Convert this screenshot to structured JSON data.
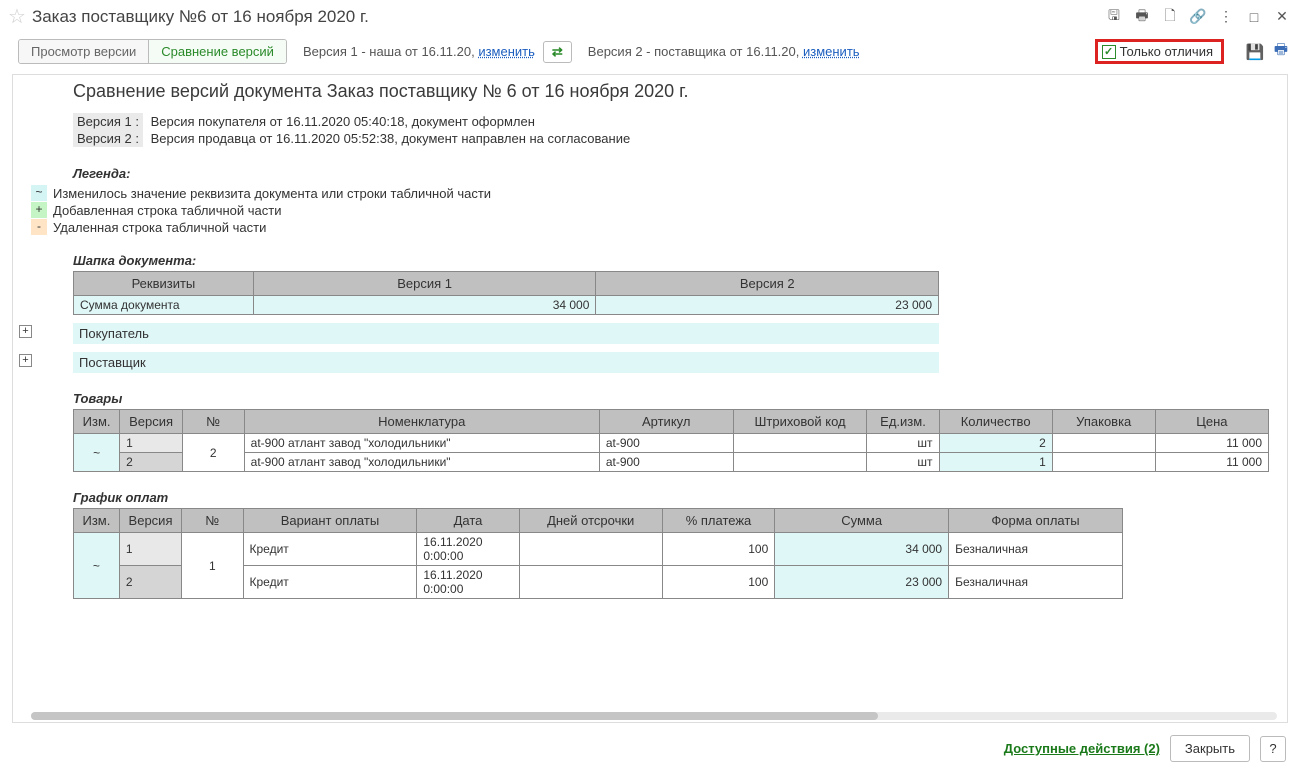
{
  "window": {
    "title": "Заказ поставщику №6 от 16 ноября 2020 г."
  },
  "toolbar": {
    "view_version": "Просмотр версии",
    "compare_versions": "Сравнение версий",
    "version1_text": "Версия 1 - наша от 16.11.20, ",
    "version2_text": "Версия 2 - поставщика от 16.11.20, ",
    "change_link": "изменить",
    "swap_glyph": "⇄",
    "diff_only": "Только отличия"
  },
  "doc": {
    "compare_title": "Сравнение версий документа Заказ поставщику № 6 от 16 ноября 2020 г.",
    "v1_label": "Версия 1 :",
    "v1_desc": "Версия покупателя от 16.11.2020 05:40:18, документ оформлен",
    "v2_label": "Версия 2 :",
    "v2_desc": "Версия продавца от 16.11.2020 05:52:38, документ направлен на согласование",
    "legend_title": "Легенда:",
    "legend": {
      "tilde": "~",
      "tilde_text": "Изменилось значение реквизита документа или строки табличной части",
      "plus": "+",
      "plus_text": "Добавленная строка табличной части",
      "minus": "-",
      "minus_text": "Удаленная строка табличной части"
    },
    "header_section": "Шапка документа:",
    "header_cols": {
      "attr": "Реквизиты",
      "v1": "Версия 1",
      "v2": "Версия 2"
    },
    "header_row": {
      "name": "Сумма документа",
      "v1": "34 000",
      "v2": "23 000"
    },
    "buyer": "Покупатель",
    "supplier": "Поставщик",
    "goods_title": "Товары",
    "goods_cols": {
      "chg": "Изм.",
      "ver": "Версия",
      "num": "№",
      "nom": "Номенклатура",
      "art": "Артикул",
      "barcode": "Штриховой код",
      "unit": "Ед.изм.",
      "qty": "Количество",
      "pack": "Упаковка",
      "price": "Цена"
    },
    "goods": {
      "change_mark": "~",
      "num": "2",
      "rows": [
        {
          "ver": "1",
          "nom": "at-900 атлант завод \"холодильники\"",
          "art": "at-900",
          "unit": "шт",
          "qty": "2",
          "price": "11 000"
        },
        {
          "ver": "2",
          "nom": "at-900 атлант завод \"холодильники\"",
          "art": "at-900",
          "unit": "шт",
          "qty": "1",
          "price": "11 000"
        }
      ]
    },
    "pay_title": "График оплат",
    "pay_cols": {
      "chg": "Изм.",
      "ver": "Версия",
      "num": "№",
      "variant": "Вариант оплаты",
      "date": "Дата",
      "days": "Дней отсрочки",
      "percent": "% платежа",
      "sum": "Сумма",
      "form": "Форма оплаты"
    },
    "pay": {
      "change_mark": "~",
      "num": "1",
      "rows": [
        {
          "ver": "1",
          "variant": "Кредит",
          "date": "16.11.2020 0:00:00",
          "percent": "100",
          "sum": "34 000",
          "form": "Безналичная"
        },
        {
          "ver": "2",
          "variant": "Кредит",
          "date": "16.11.2020 0:00:00",
          "percent": "100",
          "sum": "23 000",
          "form": "Безналичная"
        }
      ]
    }
  },
  "footer": {
    "actions": "Доступные действия (2)",
    "close": "Закрыть",
    "help": "?"
  }
}
